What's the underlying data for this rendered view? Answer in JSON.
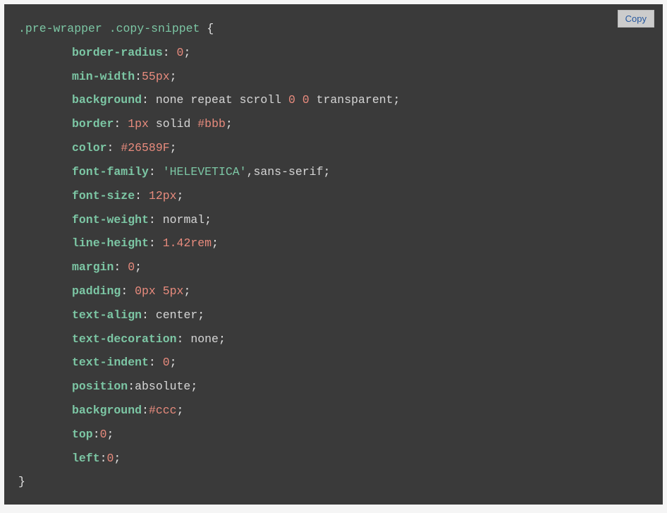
{
  "copyButton": {
    "label": "Copy"
  },
  "css": {
    "selector": ".pre-wrapper .copy-snippet",
    "openBrace": " {",
    "closeBrace": "}",
    "declarations": [
      {
        "property": "border-radius",
        "afterColon": " ",
        "parts": [
          {
            "t": "num",
            "v": "0"
          }
        ]
      },
      {
        "property": "min-width",
        "afterColon": "",
        "parts": [
          {
            "t": "num",
            "v": "55px"
          }
        ]
      },
      {
        "property": "background",
        "afterColon": " ",
        "parts": [
          {
            "t": "val",
            "v": "none repeat scroll "
          },
          {
            "t": "num",
            "v": "0 0"
          },
          {
            "t": "val",
            "v": " transparent"
          }
        ]
      },
      {
        "property": "border",
        "afterColon": " ",
        "parts": [
          {
            "t": "num",
            "v": "1px"
          },
          {
            "t": "val",
            "v": " solid "
          },
          {
            "t": "hex",
            "v": "#bbb"
          }
        ]
      },
      {
        "property": "color",
        "afterColon": " ",
        "parts": [
          {
            "t": "hex",
            "v": "#26589F"
          }
        ]
      },
      {
        "property": "font-family",
        "afterColon": " ",
        "parts": [
          {
            "t": "str",
            "v": "'HELEVETICA'"
          },
          {
            "t": "val",
            "v": ",sans-serif"
          }
        ]
      },
      {
        "property": "font-size",
        "afterColon": " ",
        "parts": [
          {
            "t": "num",
            "v": "12px"
          }
        ]
      },
      {
        "property": "font-weight",
        "afterColon": " ",
        "parts": [
          {
            "t": "val",
            "v": "normal"
          }
        ]
      },
      {
        "property": "line-height",
        "afterColon": " ",
        "parts": [
          {
            "t": "num",
            "v": "1.42rem"
          }
        ]
      },
      {
        "property": "margin",
        "afterColon": " ",
        "parts": [
          {
            "t": "num",
            "v": "0"
          }
        ]
      },
      {
        "property": "padding",
        "afterColon": " ",
        "parts": [
          {
            "t": "num",
            "v": "0px 5px"
          }
        ]
      },
      {
        "property": "text-align",
        "afterColon": " ",
        "parts": [
          {
            "t": "val",
            "v": "center"
          }
        ]
      },
      {
        "property": "text-decoration",
        "afterColon": " ",
        "parts": [
          {
            "t": "val",
            "v": "none"
          }
        ]
      },
      {
        "property": "text-indent",
        "afterColon": " ",
        "parts": [
          {
            "t": "num",
            "v": "0"
          }
        ]
      },
      {
        "property": "position",
        "afterColon": "",
        "parts": [
          {
            "t": "val",
            "v": "absolute"
          }
        ]
      },
      {
        "property": "background",
        "afterColon": "",
        "parts": [
          {
            "t": "hex",
            "v": "#ccc"
          }
        ]
      },
      {
        "property": "top",
        "afterColon": "",
        "parts": [
          {
            "t": "num",
            "v": "0"
          }
        ]
      },
      {
        "property": "left",
        "afterColon": "",
        "parts": [
          {
            "t": "num",
            "v": "0"
          }
        ]
      }
    ]
  }
}
